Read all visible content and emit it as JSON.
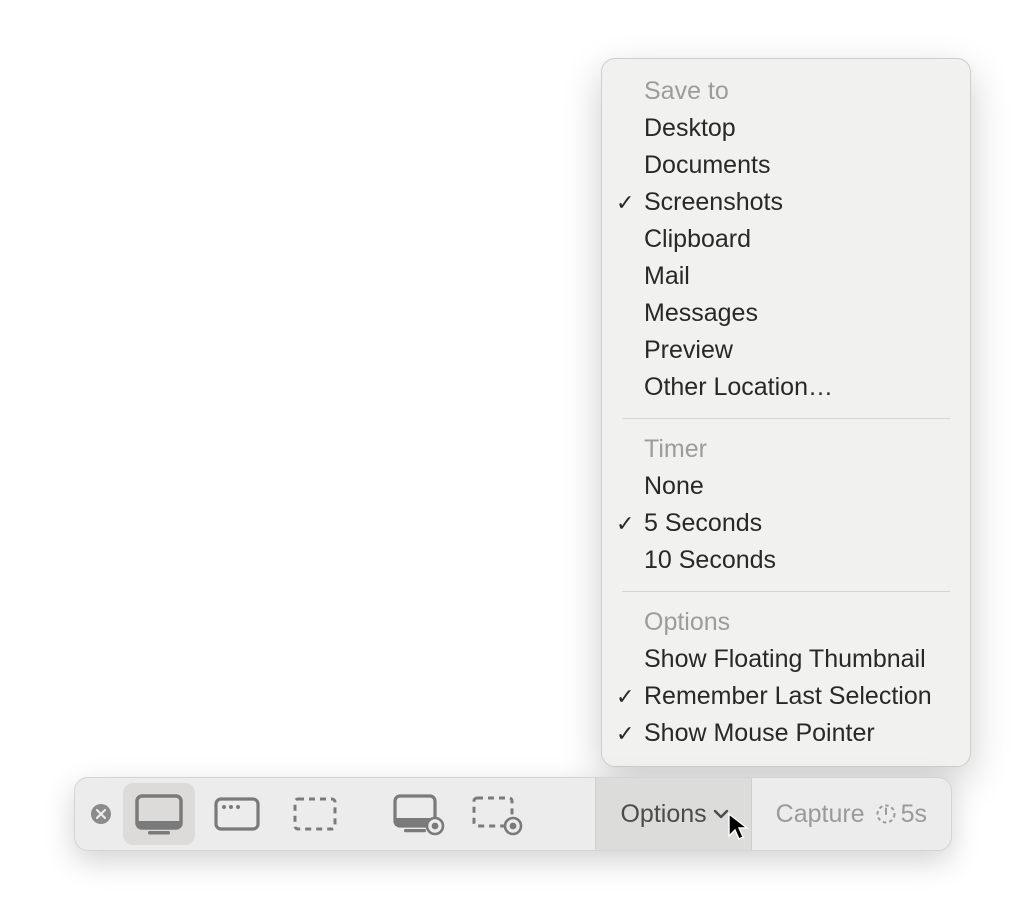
{
  "menu": {
    "sections": [
      {
        "heading": "Save to",
        "items": [
          {
            "label": "Desktop",
            "checked": false
          },
          {
            "label": "Documents",
            "checked": false
          },
          {
            "label": "Screenshots",
            "checked": true
          },
          {
            "label": "Clipboard",
            "checked": false
          },
          {
            "label": "Mail",
            "checked": false
          },
          {
            "label": "Messages",
            "checked": false
          },
          {
            "label": "Preview",
            "checked": false
          },
          {
            "label": "Other Location…",
            "checked": false
          }
        ]
      },
      {
        "heading": "Timer",
        "items": [
          {
            "label": "None",
            "checked": false
          },
          {
            "label": "5 Seconds",
            "checked": true
          },
          {
            "label": "10 Seconds",
            "checked": false
          }
        ]
      },
      {
        "heading": "Options",
        "items": [
          {
            "label": "Show Floating Thumbnail",
            "checked": false
          },
          {
            "label": "Remember Last Selection",
            "checked": true
          },
          {
            "label": "Show Mouse Pointer",
            "checked": true
          }
        ]
      }
    ]
  },
  "toolbar": {
    "close_icon": "close",
    "tools": [
      {
        "name": "capture-entire-screen",
        "selected": true
      },
      {
        "name": "capture-window",
        "selected": false
      },
      {
        "name": "capture-selection",
        "selected": false
      },
      {
        "name": "record-entire-screen",
        "selected": false
      },
      {
        "name": "record-selection",
        "selected": false
      }
    ],
    "options_label": "Options",
    "capture_label": "Capture",
    "timer_display": "5s"
  }
}
